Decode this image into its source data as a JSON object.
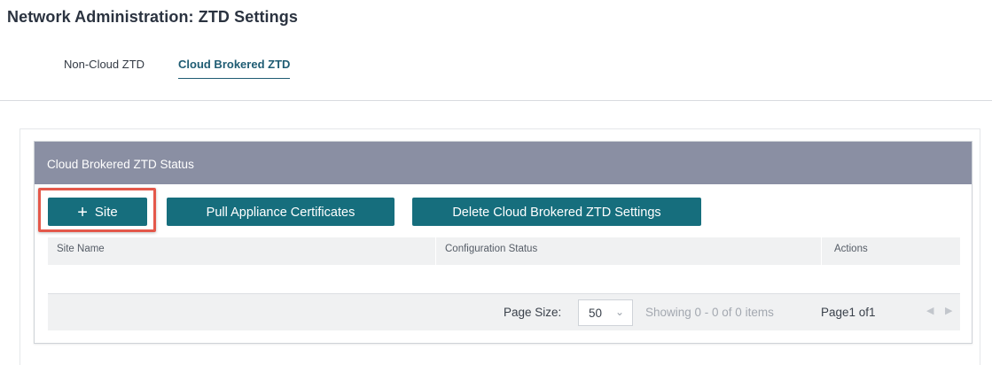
{
  "page": {
    "title": "Network Administration: ZTD Settings"
  },
  "tabs": [
    {
      "label": "Non-Cloud ZTD"
    },
    {
      "label": "Cloud Brokered ZTD",
      "active": true
    }
  ],
  "panel": {
    "header": "Cloud Brokered ZTD Status",
    "buttons": {
      "add_site": "Site",
      "add_site_icon": "plus-icon",
      "pull_certs": "Pull Appliance Certificates",
      "delete_settings": "Delete Cloud Brokered ZTD Settings"
    },
    "table": {
      "columns": [
        "Site Name",
        "Configuration Status",
        "Actions"
      ],
      "rows": []
    },
    "pager": {
      "page_size_label": "Page Size:",
      "page_size": "50",
      "showing": "Showing 0 - 0 of 0 items",
      "page_info": "Page1 of1",
      "prev_icon": "chevron-left-icon",
      "next_icon": "chevron-right-icon"
    }
  },
  "colors": {
    "accent": "#166e7d",
    "header_bg": "#8a8fa3",
    "highlight": "#e4584a",
    "active_tab": "#1f5c73"
  }
}
